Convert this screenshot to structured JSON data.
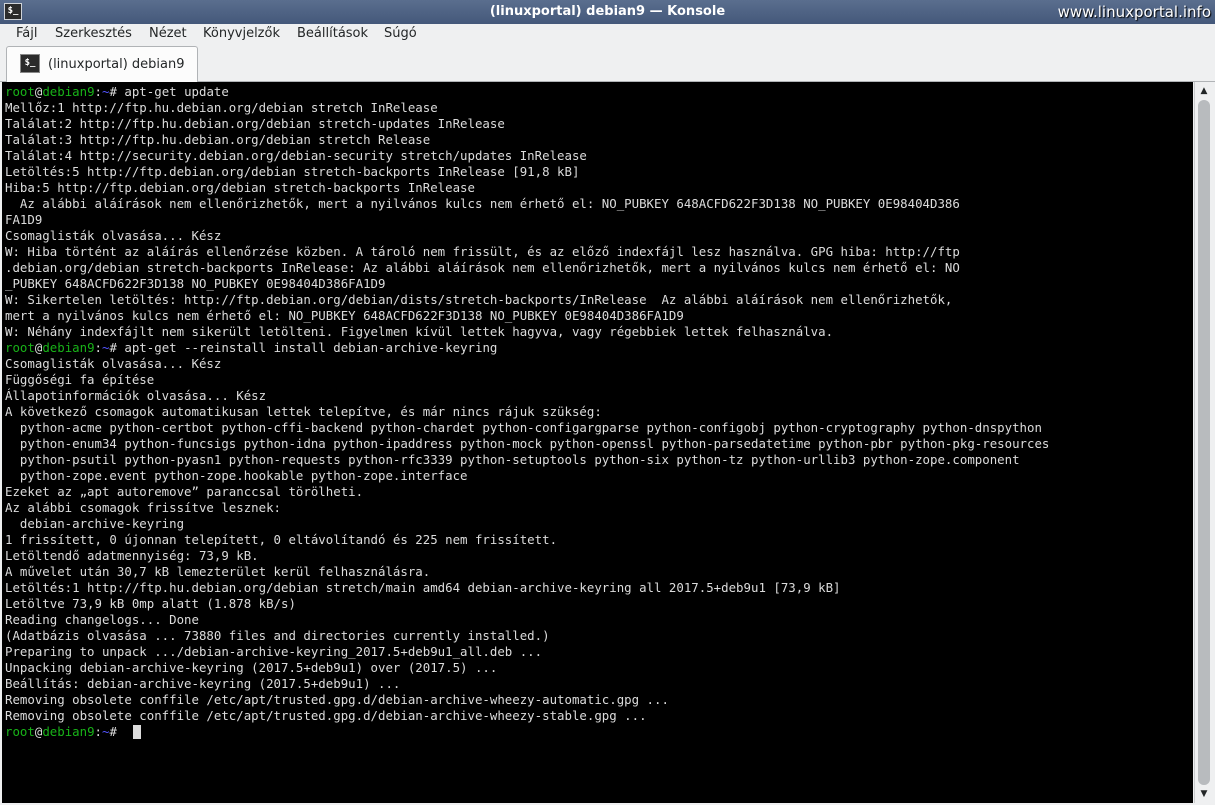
{
  "window": {
    "title": "(linuxportal) debian9 — Konsole",
    "icon_text": "$_"
  },
  "watermark": "www.linuxportal.info",
  "menu": [
    "Fájl",
    "Szerkesztés",
    "Nézet",
    "Könyvjelzők",
    "Beállítások",
    "Súgó"
  ],
  "tab": {
    "label": "(linuxportal) debian9",
    "icon_text": "$_"
  },
  "prompt": {
    "user": "root",
    "at": "@",
    "host": "debian9",
    "colon": ":",
    "path": "~",
    "sym": "# "
  },
  "colors": {
    "prompt_green": "#18b218",
    "prompt_path_blue": "#5454ff",
    "terminal_bg": "#000000",
    "terminal_fg": "#dcdcdc"
  },
  "terminal": {
    "lines": [
      {
        "prompt": true,
        "text": "apt-get update"
      },
      {
        "text": "Mellőz:1 http://ftp.hu.debian.org/debian stretch InRelease"
      },
      {
        "text": "Találat:2 http://ftp.hu.debian.org/debian stretch-updates InRelease"
      },
      {
        "text": "Találat:3 http://ftp.hu.debian.org/debian stretch Release"
      },
      {
        "text": "Találat:4 http://security.debian.org/debian-security stretch/updates InRelease"
      },
      {
        "text": "Letöltés:5 http://ftp.debian.org/debian stretch-backports InRelease [91,8 kB]"
      },
      {
        "text": "Hiba:5 http://ftp.debian.org/debian stretch-backports InRelease"
      },
      {
        "text": "  Az alábbi aláírások nem ellenőrizhetők, mert a nyilvános kulcs nem érhető el: NO_PUBKEY 648ACFD622F3D138 NO_PUBKEY 0E98404D386"
      },
      {
        "text": "FA1D9"
      },
      {
        "text": "Csomaglisták olvasása... Kész"
      },
      {
        "text": "W: Hiba történt az aláírás ellenőrzése közben. A tároló nem frissült, és az előző indexfájl lesz használva. GPG hiba: http://ftp"
      },
      {
        "text": ".debian.org/debian stretch-backports InRelease: Az alábbi aláírások nem ellenőrizhetők, mert a nyilvános kulcs nem érhető el: NO"
      },
      {
        "text": "_PUBKEY 648ACFD622F3D138 NO_PUBKEY 0E98404D386FA1D9"
      },
      {
        "text": "W: Sikertelen letöltés: http://ftp.debian.org/debian/dists/stretch-backports/InRelease  Az alábbi aláírások nem ellenőrizhetők,"
      },
      {
        "text": "mert a nyilvános kulcs nem érhető el: NO_PUBKEY 648ACFD622F3D138 NO_PUBKEY 0E98404D386FA1D9"
      },
      {
        "text": "W: Néhány indexfájlt nem sikerült letölteni. Figyelmen kívül lettek hagyva, vagy régebbiek lettek felhasználva."
      },
      {
        "prompt": true,
        "text": "apt-get --reinstall install debian-archive-keyring"
      },
      {
        "text": "Csomaglisták olvasása... Kész"
      },
      {
        "text": "Függőségi fa építése"
      },
      {
        "text": "Állapotinformációk olvasása... Kész"
      },
      {
        "text": "A következő csomagok automatikusan lettek telepítve, és már nincs rájuk szükség:"
      },
      {
        "text": "  python-acme python-certbot python-cffi-backend python-chardet python-configargparse python-configobj python-cryptography python-dnspython"
      },
      {
        "text": "  python-enum34 python-funcsigs python-idna python-ipaddress python-mock python-openssl python-parsedatetime python-pbr python-pkg-resources"
      },
      {
        "text": "  python-psutil python-pyasn1 python-requests python-rfc3339 python-setuptools python-six python-tz python-urllib3 python-zope.component"
      },
      {
        "text": "  python-zope.event python-zope.hookable python-zope.interface"
      },
      {
        "text": "Ezeket az „apt autoremove” paranccsal törölheti."
      },
      {
        "text": "Az alábbi csomagok frissítve lesznek:"
      },
      {
        "text": "  debian-archive-keyring"
      },
      {
        "text": "1 frissített, 0 újonnan telepített, 0 eltávolítandó és 225 nem frissített."
      },
      {
        "text": "Letöltendő adatmennyiség: 73,9 kB."
      },
      {
        "text": "A művelet után 30,7 kB lemezterület kerül felhasználásra."
      },
      {
        "text": "Letöltés:1 http://ftp.hu.debian.org/debian stretch/main amd64 debian-archive-keyring all 2017.5+deb9u1 [73,9 kB]"
      },
      {
        "text": "Letöltve 73,9 kB 0mp alatt (1.878 kB/s)"
      },
      {
        "text": "Reading changelogs... Done"
      },
      {
        "text": "(Adatbázis olvasása ... 73880 files and directories currently installed.)"
      },
      {
        "text": "Preparing to unpack .../debian-archive-keyring_2017.5+deb9u1_all.deb ..."
      },
      {
        "text": "Unpacking debian-archive-keyring (2017.5+deb9u1) over (2017.5) ..."
      },
      {
        "text": "Beállítás: debian-archive-keyring (2017.5+deb9u1) ..."
      },
      {
        "text": "Removing obsolete conffile /etc/apt/trusted.gpg.d/debian-archive-wheezy-automatic.gpg ..."
      },
      {
        "text": "Removing obsolete conffile /etc/apt/trusted.gpg.d/debian-archive-wheezy-stable.gpg ..."
      },
      {
        "prompt": true,
        "text": "",
        "cursor": true
      }
    ]
  },
  "scrollbar": {
    "position_fraction": 1.0
  }
}
